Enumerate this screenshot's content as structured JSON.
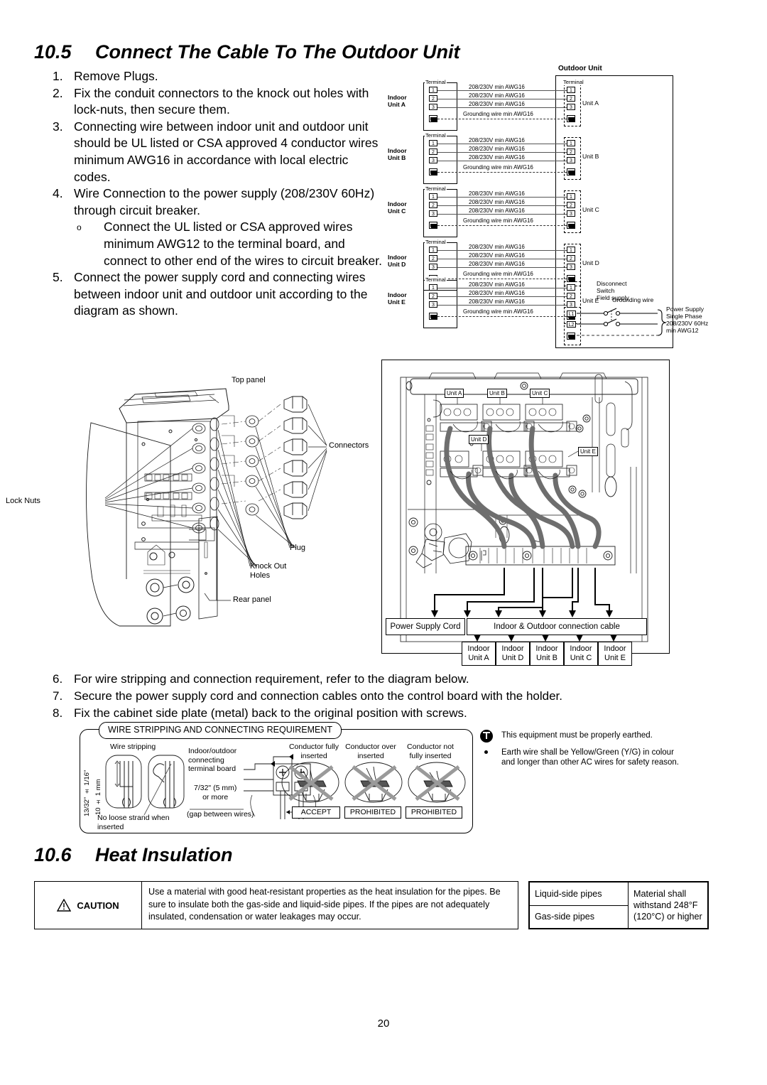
{
  "page_number": "20",
  "sections": {
    "s105": {
      "number": "10.5",
      "title": "Connect The Cable To The Outdoor Unit"
    },
    "s106": {
      "number": "10.6",
      "title": "Heat Insulation"
    }
  },
  "steps": [
    {
      "n": "1.",
      "text": "Remove Plugs."
    },
    {
      "n": "2.",
      "text": "Fix the conduit connectors to the knock out holes with lock-nuts, then secure them."
    },
    {
      "n": "3.",
      "text": "Connecting wire between indoor unit and outdoor unit should be UL listed or CSA approved 4 conductor wires minimum AWG16 in accordance with local electric codes."
    },
    {
      "n": "4.",
      "text": "Wire Connection to the power supply (208/230V 60Hz) through circuit breaker."
    },
    {
      "n": "5.",
      "text": "Connect the power supply cord and connecting wires between indoor unit and outdoor unit according to the diagram as shown."
    }
  ],
  "substep": {
    "bullet": "o",
    "text": "Connect the UL listed or CSA approved wires minimum AWG12 to the terminal board, and connect to other end of the wires to circuit breaker."
  },
  "steps2": [
    {
      "n": "6.",
      "text": "For wire stripping and connection requirement, refer to the diagram below."
    },
    {
      "n": "7.",
      "text": "Secure the power supply cord and connection cables onto the control board with the holder."
    },
    {
      "n": "8.",
      "text": "Fix the cabinet side plate (metal) back to the original position with screws."
    }
  ],
  "wiring": {
    "outdoor_unit_label": "Outdoor Unit",
    "terminal_label": "Terminal",
    "wire_label": "208/230V min AWG16",
    "ground_label": "Grounding wire min AWG16",
    "terminal_numbers": [
      "1",
      "2",
      "3"
    ],
    "units": [
      {
        "indoor_label": "Indoor\nUnit A",
        "indoor_l1": "Indoor",
        "indoor_l2": "Unit A",
        "outdoor_label": "Unit A"
      },
      {
        "indoor_label": "Indoor\nUnit B",
        "indoor_l1": "Indoor",
        "indoor_l2": "Unit B",
        "outdoor_label": "Unit B"
      },
      {
        "indoor_label": "Indoor\nUnit C",
        "indoor_l1": "Indoor",
        "indoor_l2": "Unit C",
        "outdoor_label": "Unit C"
      },
      {
        "indoor_label": "Indoor\nUnit D",
        "indoor_l1": "Indoor",
        "indoor_l2": "Unit D",
        "outdoor_label": "Unit D"
      },
      {
        "indoor_label": "Indoor\nUnit E",
        "indoor_l1": "Indoor",
        "indoor_l2": "Unit E",
        "outdoor_label": "Unit E"
      }
    ],
    "power": {
      "l1": "L1",
      "l2": "L2",
      "disconnect_l1": "Disconnect",
      "disconnect_l2": "Switch",
      "disconnect_l3": "Field supply",
      "grounding_wire": "Grounding wire",
      "supply_l1": "Power Supply",
      "supply_l2": "Single Phase",
      "supply_l3": "208/230V 60Hz",
      "supply_l4": "min AWG12"
    }
  },
  "left_illustration": {
    "callouts": {
      "top_panel": "Top panel",
      "connectors": "Connectors",
      "lock_nuts": "Lock Nuts",
      "plug": "Plug",
      "knock_out_1": "Knock Out",
      "knock_out_2": "Holes",
      "rear_panel": "Rear panel"
    }
  },
  "right_illustration": {
    "unit_tags": [
      "Unit A",
      "Unit B",
      "Unit C",
      "Unit D",
      "Unit E"
    ],
    "power_supply_cord": "Power Supply Cord",
    "connection_cable": "Indoor & Outdoor connection cable",
    "indoor_boxes": [
      {
        "l1": "Indoor",
        "l2": "Unit A"
      },
      {
        "l1": "Indoor",
        "l2": "Unit D"
      },
      {
        "l1": "Indoor",
        "l2": "Unit B"
      },
      {
        "l1": "Indoor",
        "l2": "Unit C"
      },
      {
        "l1": "Indoor",
        "l2": "Unit E"
      }
    ]
  },
  "wire_stripping": {
    "title": "WIRE STRIPPING AND CONNECTING REQUIREMENT",
    "wire_stripping_label": "Wire stripping",
    "dim_imperial": "13/32\" ± 1/16\"",
    "dim_metric": "10 ± 1 mm",
    "no_loose_1": "No loose strand when",
    "no_loose_2": "inserted",
    "terminal_board_1": "Indoor/outdoor",
    "terminal_board_2": "connecting",
    "terminal_board_3": "terminal board",
    "gap_1": "7/32\" (5 mm)",
    "gap_2": "or more",
    "gap_3": "(gap between wires)",
    "cases": [
      {
        "cap1": "Conductor fully",
        "cap2": "inserted",
        "stamp": "ACCEPT"
      },
      {
        "cap1": "Conductor over",
        "cap2": "inserted",
        "stamp": "PROHIBITED"
      },
      {
        "cap1": "Conductor not",
        "cap2": "fully inserted",
        "stamp": "PROHIBITED"
      }
    ]
  },
  "earth_notes": {
    "main": "This equipment must be properly earthed.",
    "bullet_l1": "Earth wire shall be Yellow/Green (Y/G) in colour",
    "bullet_l2": "and longer than other AC wires for safety reason."
  },
  "caution": {
    "label": "CAUTION",
    "text": "Use a material with good heat-resistant properties as the heat insulation for the pipes. Be sure to insulate both the gas-side and liquid-side pipes. If the pipes are not adequately insulated, condensation or water leakages may occur."
  },
  "pipe_table": {
    "liquid": "Liquid-side pipes",
    "gas": "Gas-side pipes",
    "material_l1": "Material shall",
    "material_l2": "withstand 248°F",
    "material_l3": "(120°C) or higher"
  }
}
